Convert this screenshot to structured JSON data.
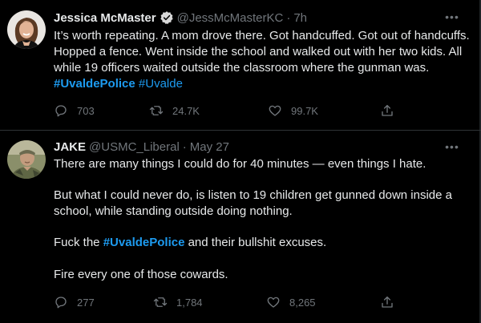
{
  "tweets": [
    {
      "author": "Jessica McMaster",
      "handle": "@JessMcMasterKC",
      "separator": "·",
      "time": "7h",
      "verified": true,
      "text_before": "It’s worth repeating. A mom drove there. Got handcuffed. Got out of handcuffs. Hopped a fence. Went inside the school and walked out with her two kids. All while 19 officers waited outside the classroom where the gunman was. ",
      "hashtag1": "#UvaldePolice",
      "hashtag2": "#Uvalde",
      "replies": "703",
      "retweets": "24.7K",
      "likes": "99.7K"
    },
    {
      "author": "JAKE",
      "handle": "@USMC_Liberal",
      "separator": "·",
      "time": "May 27",
      "verified": false,
      "para1": "There are many things I could do for 40 minutes — even things I hate.",
      "para2": "But what I could never do, is listen to 19 children get gunned down inside a school, while standing outside doing nothing.",
      "para3_before": "Fuck the ",
      "para3_hashtag": "#UvaldePolice",
      "para3_after": " and their bullshit excuses.",
      "para4": "Fire every one of those cowards.",
      "replies": "277",
      "retweets": "1,784",
      "likes": "8,265"
    }
  ],
  "colors": {
    "background": "#000000",
    "text": "#e7e9ea",
    "muted": "#71767b",
    "link": "#1d9bf0",
    "divider": "#2f3336"
  },
  "icons": [
    "verified-badge-icon",
    "more-icon",
    "reply-icon",
    "retweet-icon",
    "like-icon",
    "share-icon"
  ]
}
